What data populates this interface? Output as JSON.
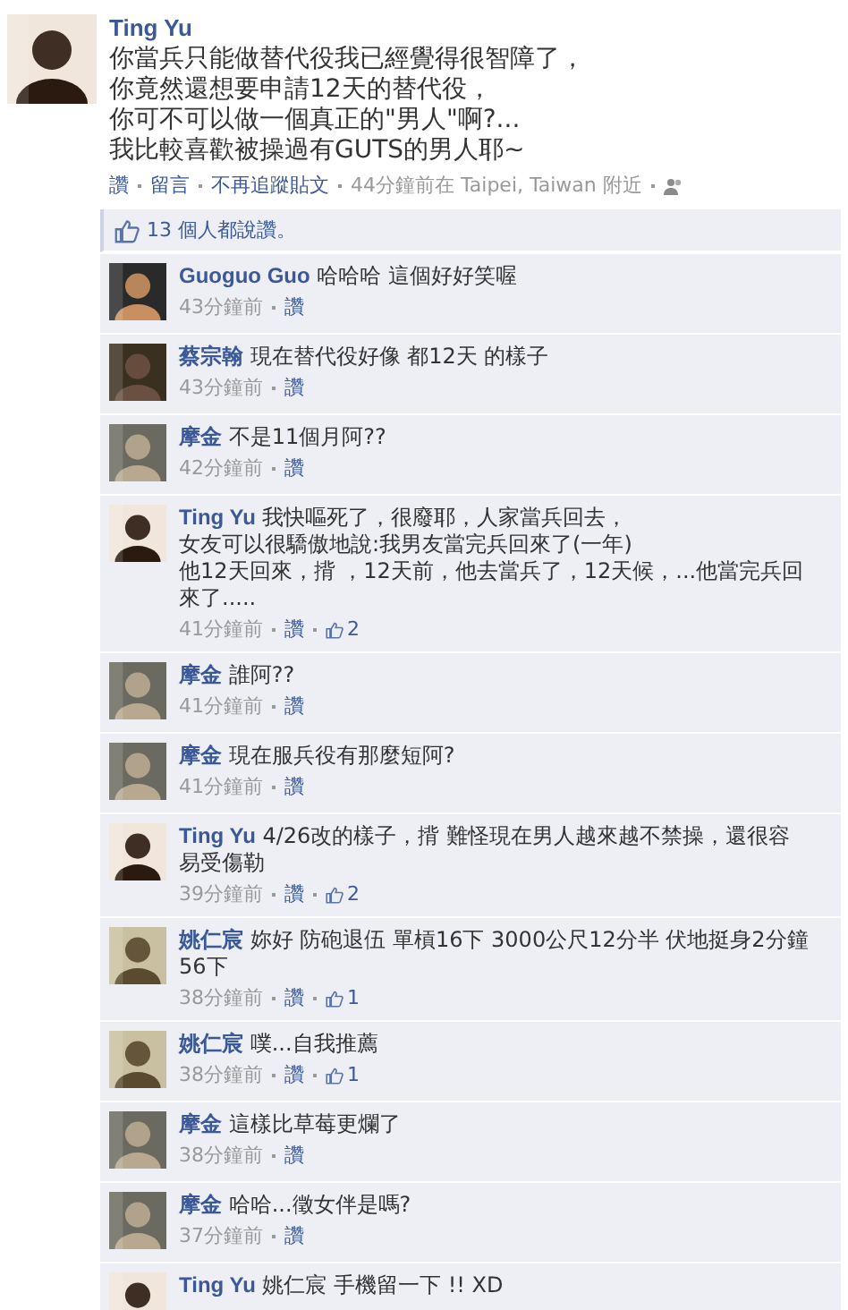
{
  "post": {
    "author": "Ting Yu",
    "lines": [
      "你當兵只能做替代役我已經覺得很智障了，",
      "你竟然還想要申請12天的替代役，",
      "你可不可以做一個真正的\"男人\"啊?...",
      "我比較喜歡被操過有GUTS的男人耶~"
    ],
    "actions": [
      {
        "kind": "link",
        "text": "讚"
      },
      {
        "kind": "link",
        "text": "留言"
      },
      {
        "kind": "link",
        "text": "不再追蹤貼文"
      },
      {
        "kind": "plain",
        "text": "44分鐘前在 Taipei, Taiwan 附近"
      },
      {
        "kind": "icon"
      }
    ]
  },
  "likes_bar": {
    "text": "13 個人都說讚。"
  },
  "comments": [
    {
      "author": "Guoguo Guo",
      "text": "哈哈哈 這個好好笑喔",
      "time": "43分鐘前",
      "like": "讚"
    },
    {
      "author": "蔡宗翰",
      "text": "現在替代役好像 都12天 的樣子",
      "time": "43分鐘前",
      "like": "讚"
    },
    {
      "author": "摩金",
      "text": "不是11個月阿??",
      "time": "42分鐘前",
      "like": "讚"
    },
    {
      "author": "Ting Yu",
      "text": "我快嘔死了，很廢耶，人家當兵回去，",
      "more_lines": [
        "女友可以很驕傲地說:我男友當完兵回來了(一年)",
        "他12天回來，揹 ，12天前，他去當兵了，12天候，...他當完兵回來了....."
      ],
      "time": "41分鐘前",
      "like": "讚",
      "likes": "2"
    },
    {
      "author": "摩金",
      "text": "誰阿??",
      "time": "41分鐘前",
      "like": "讚"
    },
    {
      "author": "摩金",
      "text": "現在服兵役有那麼短阿?",
      "time": "41分鐘前",
      "like": "讚"
    },
    {
      "author": "Ting Yu",
      "text": "4/26改的樣子，揹 難怪現在男人越來越不禁操，還很容易受傷勒",
      "time": "39分鐘前",
      "like": "讚",
      "likes": "2"
    },
    {
      "author": "姚仁宸",
      "text": "妳好 防砲退伍 單槓16下 3000公尺12分半 伏地挺身2分鐘56下",
      "time": "38分鐘前",
      "like": "讚",
      "likes": "1"
    },
    {
      "author": "姚仁宸",
      "text": "噗...自我推薦",
      "time": "38分鐘前",
      "like": "讚",
      "likes": "1"
    },
    {
      "author": "摩金",
      "text": "這樣比草莓更爛了",
      "time": "38分鐘前",
      "like": "讚"
    },
    {
      "author": "摩金",
      "text": "哈哈...徵女伴是嗎?",
      "time": "37分鐘前",
      "like": "讚"
    },
    {
      "author": "Ting Yu",
      "text": "姚仁宸 手機留一下 !! XD"
    }
  ]
}
